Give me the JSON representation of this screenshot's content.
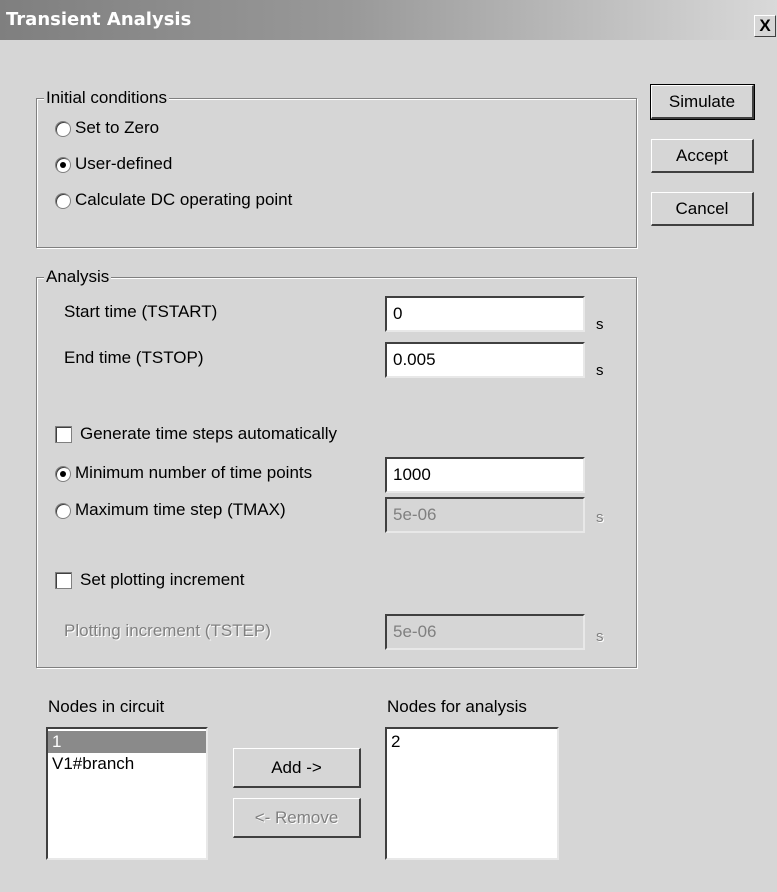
{
  "window": {
    "title": "Transient Analysis",
    "close_label": "X"
  },
  "buttons": {
    "simulate": "Simulate",
    "accept": "Accept",
    "cancel": "Cancel",
    "add": "Add ->",
    "remove": "<- Remove"
  },
  "initial_conditions": {
    "label": "Initial conditions",
    "options": [
      "Set to Zero",
      "User-defined",
      "Calculate DC operating point"
    ],
    "selected": "User-defined"
  },
  "analysis": {
    "label": "Analysis",
    "start_label": "Start time (TSTART)",
    "start_value": "0",
    "stop_label": "End time (TSTOP)",
    "stop_value": "0.005",
    "unit_s": "s",
    "auto_steps_label": "Generate time steps automatically",
    "auto_steps_checked": false,
    "min_points_label": "Minimum number of time points",
    "min_points_value": "1000",
    "max_step_label": "Maximum time step (TMAX)",
    "max_step_value": "5e-06",
    "step_mode_selected": "Minimum number of time points",
    "plot_inc_label": "Set plotting increment",
    "plot_inc_checked": false,
    "tstep_label": "Plotting increment (TSTEP)",
    "tstep_value": "5e-06"
  },
  "nodes": {
    "circuit_label": "Nodes in circuit",
    "circuit_items": [
      "1",
      "V1#branch"
    ],
    "circuit_selected": "1",
    "analysis_label": "Nodes for analysis",
    "analysis_items": [
      "2"
    ]
  }
}
